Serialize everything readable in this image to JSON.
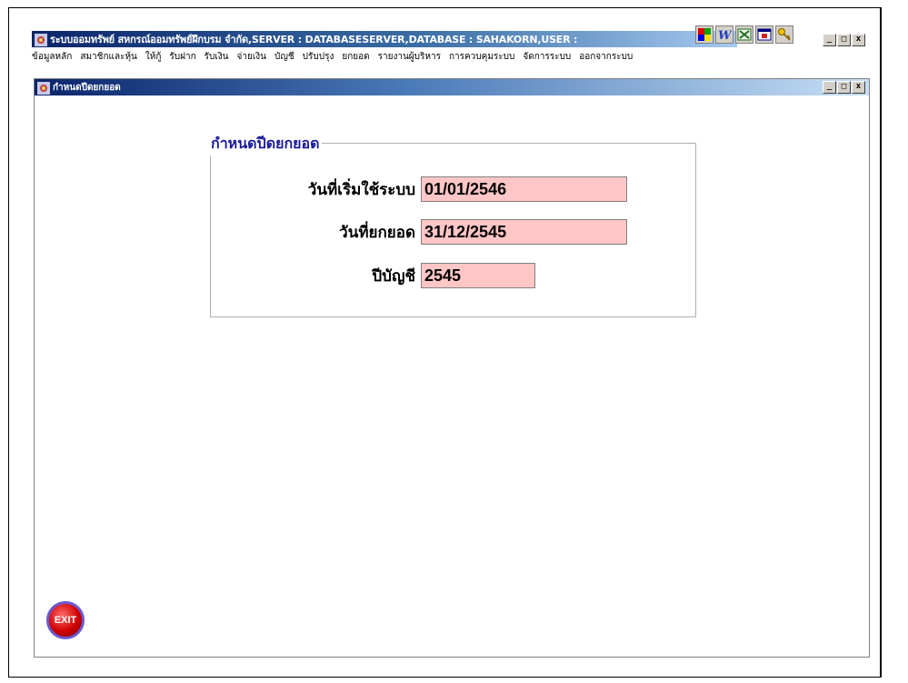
{
  "app": {
    "title": "ระบบออมทรัพย์ สหกรณ์ออมทรัพย์ฝึกบรม จำกัด,SERVER : DATABASESERVER,DATABASE : SAHAKORN,USER :"
  },
  "window_controls": {
    "minimize": "_",
    "maximize": "□",
    "close": "x"
  },
  "menu": [
    "ข้อมูลหลัก",
    "สมาชิกและหุ้น",
    "ให้กู้",
    "รับฝาก",
    "รับเงิน",
    "จ่ายเงิน",
    "บัญชี",
    "ปรับปรุง",
    "ยกยอด",
    "รายงานผู้บริหาร",
    "การควบคุมระบบ",
    "จัดการระบบ",
    "ออกจากระบบ"
  ],
  "child_window": {
    "title": "กำหนดปีดยกยอด"
  },
  "form": {
    "group_title": "กำหนดปีดยกยอด",
    "start_date_label": "วันที่เริ่มใช้ระบบ",
    "start_date_value": "01/01/2546",
    "carry_date_label": "วันที่ยกยอด",
    "carry_date_value": "31/12/2545",
    "fiscal_year_label": "ปีบัญชี",
    "fiscal_year_value": "2545"
  },
  "exit_button": {
    "label": "EXIT"
  },
  "colors": {
    "title_bar": "#0a246a",
    "field_bg": "#ffc6c6",
    "group_title": "#1a1a9a"
  }
}
